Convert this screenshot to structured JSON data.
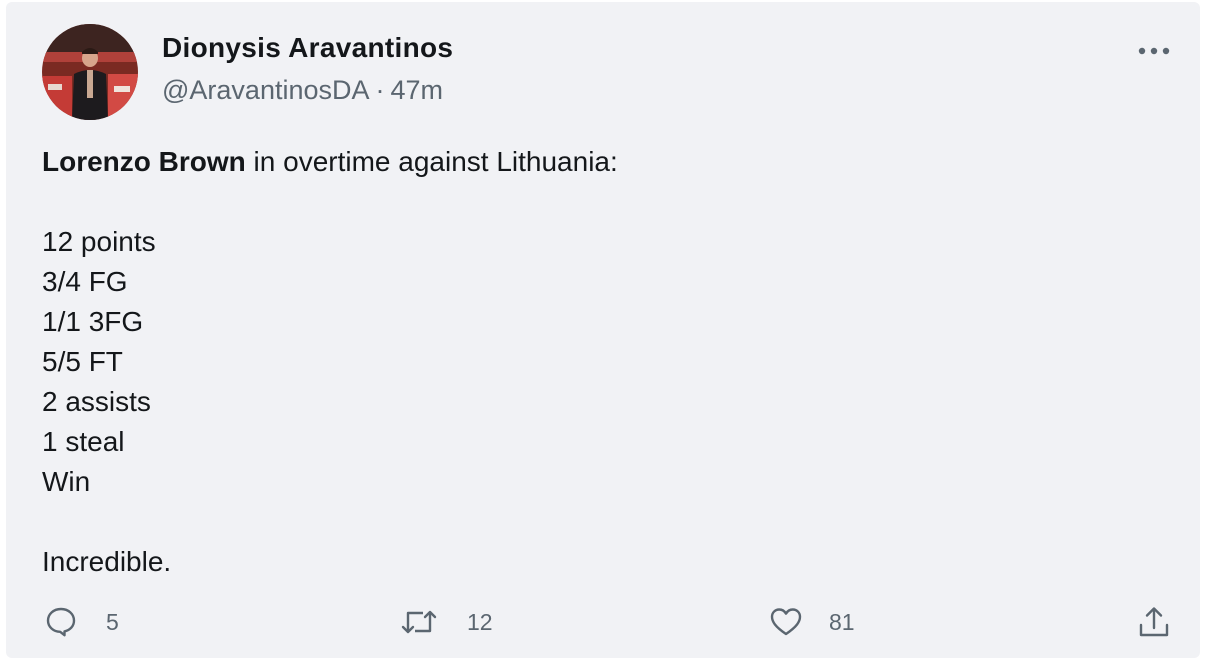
{
  "tweet": {
    "author": {
      "display_name": "Dionysis Aravantinos",
      "handle": "@AravantinosDA",
      "separator": "·",
      "time_ago": "47m"
    },
    "body": {
      "intro_bold": "Lorenzo Brown",
      "intro_rest": " in overtime against Lithuania:",
      "stats": [
        "12 points",
        "3/4 FG",
        "1/1 3FG",
        "5/5 FT",
        "2 assists",
        "1 steal",
        "Win"
      ],
      "closing": "Incredible."
    },
    "actions": {
      "reply_count": "5",
      "retweet_count": "12",
      "like_count": "81"
    }
  },
  "icons": {
    "more": "more-horizontal-icon",
    "reply": "reply-bubble-icon",
    "retweet": "retweet-arrows-icon",
    "like": "heart-icon",
    "share": "share-upload-icon"
  },
  "colors": {
    "card_background": "#f1f2f5",
    "text_primary": "#14171a",
    "text_secondary": "#5b6670"
  }
}
